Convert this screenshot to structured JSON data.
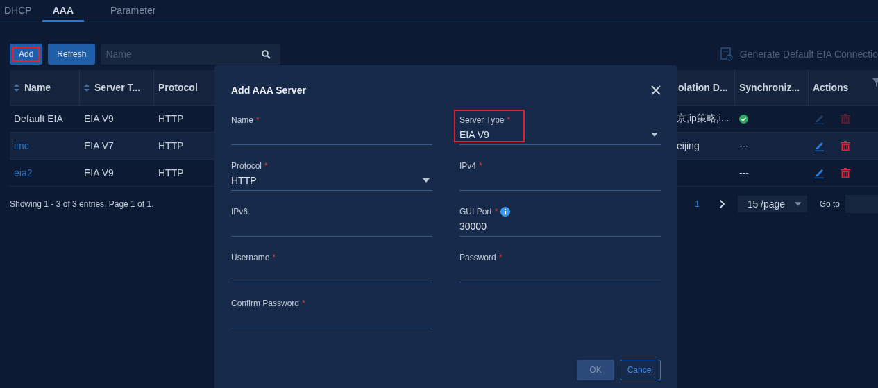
{
  "tabs": [
    {
      "label": "DHCP",
      "selected": false
    },
    {
      "label": "AAA",
      "selected": true
    },
    {
      "label": "Parameter",
      "selected": false
    }
  ],
  "toolbar": {
    "buttons": [
      {
        "label": "Add",
        "highlighted": true
      },
      {
        "label": "Refresh",
        "highlighted": false
      }
    ],
    "search": {
      "placeholder": "Name"
    },
    "generate_link": "Generate Default EIA Connectio"
  },
  "table": {
    "columns": [
      {
        "label": "Name",
        "sortable": true
      },
      {
        "label": "Server T...",
        "sortable": true
      },
      {
        "label": "Protocol",
        "sortable": false
      },
      {
        "label": "olation D...",
        "sortable": false
      },
      {
        "label": "Synchroniz...",
        "sortable": false
      },
      {
        "label": "Actions",
        "sortable": false
      }
    ],
    "rows": [
      {
        "name": "Default EIA",
        "link": false,
        "server_type": "EIA V9",
        "protocol": "HTTP",
        "column_4": "京,ip策略,i...",
        "sync": {
          "kind": "ok"
        },
        "actions_disabled": true
      },
      {
        "name": "imc",
        "link": true,
        "server_type": "EIA V7",
        "protocol": "HTTP",
        "column_4": "eijing",
        "sync": {
          "kind": "text",
          "text": "---"
        },
        "actions_disabled": false
      },
      {
        "name": "eia2",
        "link": true,
        "server_type": "EIA V9",
        "protocol": "HTTP",
        "sync": {
          "kind": "text",
          "text": "---"
        },
        "actions_disabled": false
      }
    ]
  },
  "footer": {
    "summary": "Showing 1 - 3 of 3 entries. Page 1 of 1.",
    "page": "1",
    "page_size": "15 /page",
    "goto_label": "Go to"
  },
  "dialog": {
    "title": "Add AAA Server",
    "fields": [
      {
        "label": "Name",
        "required_mark": "*",
        "kind": "text",
        "highlighted": false,
        "info": false
      },
      {
        "label": "Server Type",
        "required_mark": "*",
        "kind": "select",
        "value": "EIA V9",
        "highlighted": true,
        "info": false
      },
      {
        "label": "Protocol",
        "required_mark": "*",
        "kind": "select",
        "value": "HTTP",
        "highlighted": false,
        "info": false
      },
      {
        "label": "IPv4",
        "required_mark": "*",
        "kind": "text",
        "highlighted": false,
        "info": false
      },
      {
        "label": "IPv6",
        "kind": "text",
        "highlighted": false,
        "info": false
      },
      {
        "label": "GUI Port",
        "required_mark": "*",
        "kind": "text",
        "value": "30000",
        "highlighted": false,
        "info": true
      },
      {
        "label": "Username",
        "required_mark": "*",
        "kind": "text",
        "highlighted": false,
        "info": false
      },
      {
        "label": "Password",
        "required_mark": "*",
        "kind": "text",
        "highlighted": false,
        "info": false
      },
      {
        "label": "Confirm Password",
        "required_mark": "*",
        "kind": "text",
        "highlighted": false,
        "info": false
      }
    ],
    "buttons": [
      {
        "label": "OK",
        "kind": "primary",
        "disabled": true
      },
      {
        "label": "Cancel",
        "kind": "secondary",
        "disabled": false
      }
    ]
  }
}
